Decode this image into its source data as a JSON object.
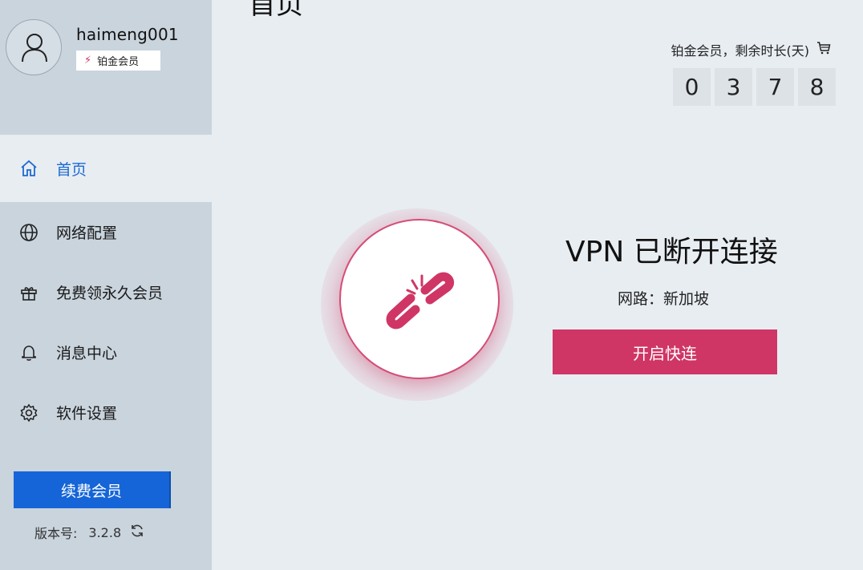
{
  "user": {
    "username": "haimeng001",
    "badge": "铂金会员"
  },
  "nav": {
    "items": [
      {
        "label": "首页",
        "icon": "home-icon"
      },
      {
        "label": "网络配置",
        "icon": "globe-icon"
      },
      {
        "label": "免费领永久会员",
        "icon": "gift-icon"
      },
      {
        "label": "消息中心",
        "icon": "bell-icon"
      },
      {
        "label": "软件设置",
        "icon": "gear-icon"
      }
    ]
  },
  "sidebar": {
    "renew_label": "续费会员",
    "version_label": "版本号:",
    "version_value": "3.2.8"
  },
  "main": {
    "page_title": "首页",
    "member_label": "铂金会员，剩余时长(天)",
    "days_digits": [
      "0",
      "3",
      "7",
      "8"
    ],
    "status_title": "VPN 已断开连接",
    "route_label": "网路：新加坡",
    "connect_label": "开启快连"
  },
  "colors": {
    "accent_blue": "#1565d8",
    "accent_pink": "#cf3665",
    "sidebar_bg": "#c9d4dd",
    "main_bg": "#e8edf2"
  }
}
